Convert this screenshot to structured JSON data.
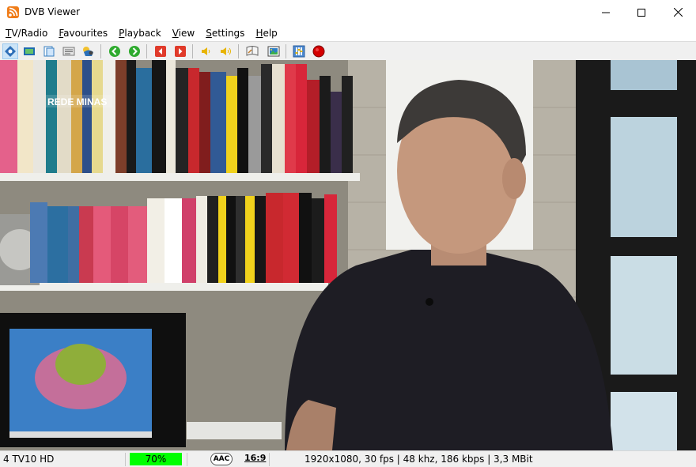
{
  "window": {
    "title": "DVB Viewer"
  },
  "menu": [
    {
      "first": "T",
      "rest": "V/Radio"
    },
    {
      "first": "F",
      "rest": "avourites"
    },
    {
      "first": "P",
      "rest": "layback"
    },
    {
      "first": "V",
      "rest": "iew"
    },
    {
      "first": "S",
      "rest": "ettings"
    },
    {
      "first": "H",
      "rest": "elp"
    }
  ],
  "toolbar": {
    "icons": [
      "osd-icon",
      "tv-mode-icon",
      "tv-window-icon",
      "teletext-icon",
      "epg-icon",
      "back-icon",
      "forward-icon",
      "previous-channel-icon",
      "next-channel-icon",
      "volume-down-icon",
      "volume-up-icon",
      "timeshift-icon",
      "picture-icon",
      "equalizer-icon",
      "record-icon"
    ]
  },
  "video": {
    "channel_watermark": "REDE MINAS"
  },
  "status": {
    "channel": "4 TV10 HD",
    "signal": "70%",
    "signal_value": 0.7,
    "audio_codec": "AAC",
    "aspect_ratio": "16:9",
    "stream_info": "1920x1080, 30 fps | 48 khz, 186 kbps | 3,3 MBit"
  },
  "colors": {
    "signal_bar": "#00ff00",
    "record": "#d40000",
    "nav_green": "#2eaa2e",
    "nav_red": "#e03a2a"
  }
}
